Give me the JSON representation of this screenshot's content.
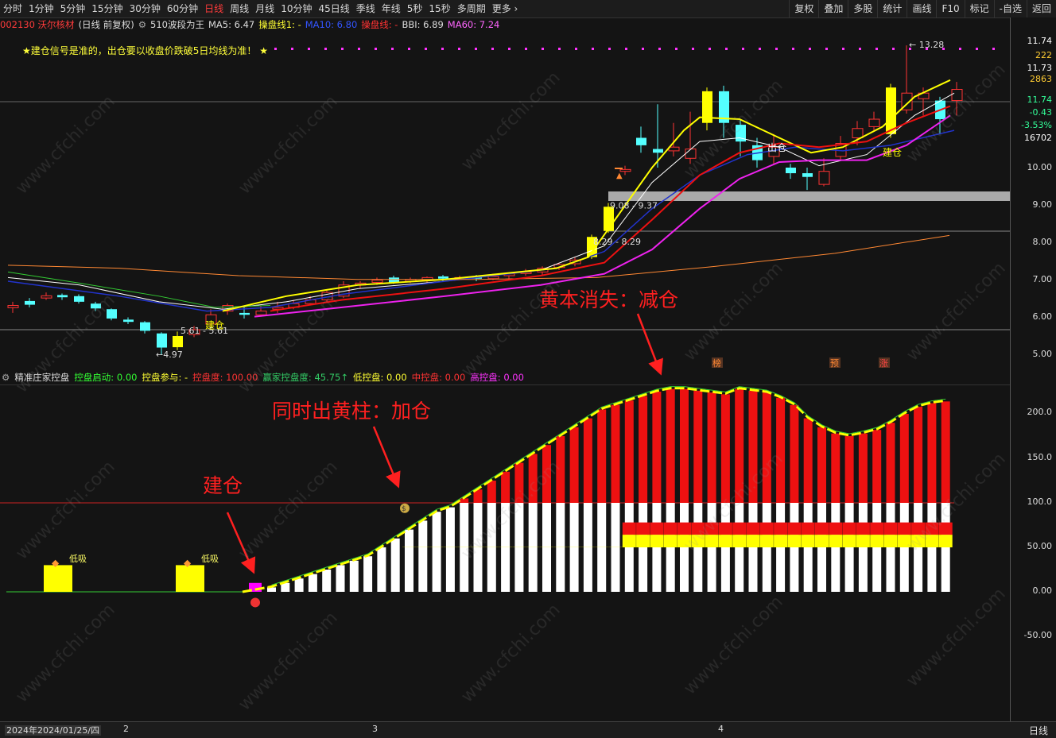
{
  "toolbar": {
    "tabs": [
      "分时",
      "1分钟",
      "5分钟",
      "15分钟",
      "30分钟",
      "60分钟",
      "日线",
      "周线",
      "月线",
      "10分钟",
      "45日线",
      "季线",
      "年线",
      "5秒",
      "15秒",
      "多周期",
      "更多"
    ],
    "active_tab": "日线",
    "right_buttons": [
      "复权",
      "叠加",
      "多股",
      "统计",
      "画线",
      "F10",
      "标记",
      "-自选",
      "返回"
    ]
  },
  "stock": {
    "code_name": "002130 沃尔核材",
    "mode": "(日线 前复权)",
    "indicator_name": "510波段为王",
    "ma5": "MA5: 6.47",
    "line1": "操盘线1: -",
    "ma10": "MA10: 6.80",
    "line2": "操盘线: -",
    "bbi": "BBI: 6.89",
    "ma60": "MA60: 7.24"
  },
  "note": "★建仓信号是准的，出仓要以收盘价跌破5日均线为准！ ★",
  "main_chart": {
    "ylabels": [
      "11.74",
      "222",
      "11.73",
      "2863",
      "11.74",
      "-0.43",
      "-3.53%",
      "16702",
      "10.00",
      "9.00",
      "8.00",
      "7.00",
      "6.00",
      "5.00"
    ],
    "ylabel_colors": [
      "#ffffff",
      "#ffcc33",
      "#ffffff",
      "#ffcc33",
      "#33ff99",
      "#33ff99",
      "#33ff99",
      "#ffffff",
      "#dddddd",
      "#dddddd",
      "#dddddd",
      "#dddddd",
      "#dddddd",
      "#dddddd"
    ],
    "high_label": "13.28",
    "low_label": "4.97",
    "range1": "5.61 - 5.61",
    "range2": "8.29 - 8.29",
    "range3": "9.08 - 9.37",
    "signal_buy1": "建仓",
    "signal_sell": "出仓",
    "signal_buy2": "建仓",
    "badges": [
      "榜",
      "预",
      "涨"
    ]
  },
  "sub_chart": {
    "title": "精准庄家控盘",
    "items": [
      {
        "label": "控盘启动: 0.00",
        "color": "#33ff33"
      },
      {
        "label": "控盘参与: -",
        "color": "#ffff33"
      },
      {
        "label": "控盘度: 100.00",
        "color": "#ff3333"
      },
      {
        "label": "赢家控盘度: 45.75↑",
        "color": "#33cc66"
      },
      {
        "label": "低控盘: 0.00",
        "color": "#ffff33"
      },
      {
        "label": "中控盘: 0.00",
        "color": "#ff3333"
      },
      {
        "label": "高控盘: 0.00",
        "color": "#ff33ff"
      }
    ],
    "ylabels": [
      "200.0",
      "150.0",
      "100.0",
      "50.00",
      "0.00",
      "-50.00"
    ],
    "low_absorb": "低吸",
    "chart_data": {
      "type": "bar",
      "series": [
        {
          "name": "控盘度",
          "values": [
            5,
            10,
            15,
            20,
            25,
            30,
            35,
            40,
            50,
            60,
            70,
            80,
            90,
            95,
            105,
            115,
            125,
            135,
            145,
            155,
            165,
            175,
            185,
            195,
            205,
            210,
            215,
            220,
            225,
            228,
            228,
            226,
            224,
            222,
            228,
            226,
            224,
            218,
            210,
            195,
            185,
            178,
            175,
            178,
            182,
            190,
            200,
            208,
            212,
            214
          ]
        }
      ]
    }
  },
  "annotations": {
    "build": "建仓",
    "add": "同时出黄柱：加仓",
    "reduce": "黄本消失：减仓"
  },
  "bottom": {
    "date": "2024年2024/01/25/四",
    "ticks": [
      "2",
      "3",
      "4"
    ],
    "period": "日线"
  },
  "watermark": "www.cfchi.com"
}
